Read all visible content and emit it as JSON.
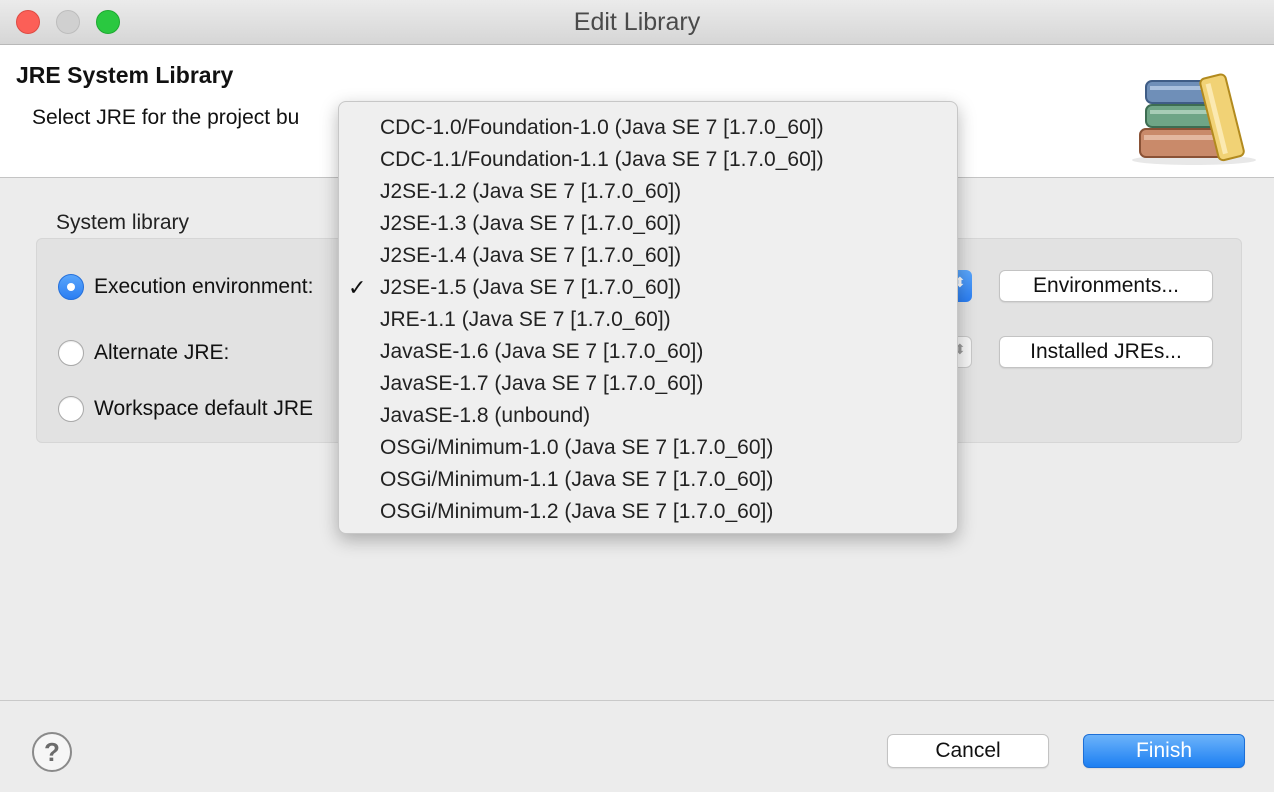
{
  "window": {
    "title": "Edit Library"
  },
  "banner": {
    "title": "JRE System Library",
    "description": "Select JRE for the project bu",
    "icon": "library-books-icon"
  },
  "system_library": {
    "label": "System library",
    "options": [
      {
        "label": "Execution environment:",
        "selected": true
      },
      {
        "label": "Alternate JRE:",
        "selected": false
      },
      {
        "label": "Workspace default JRE",
        "selected": false
      }
    ],
    "environments_button": "Environments...",
    "installed_jres_button": "Installed JREs..."
  },
  "dropdown": {
    "selected_index": 5,
    "check_glyph": "✓",
    "items": [
      "CDC-1.0/Foundation-1.0 (Java SE 7 [1.7.0_60])",
      "CDC-1.1/Foundation-1.1 (Java SE 7 [1.7.0_60])",
      "J2SE-1.2 (Java SE 7 [1.7.0_60])",
      "J2SE-1.3 (Java SE 7 [1.7.0_60])",
      "J2SE-1.4 (Java SE 7 [1.7.0_60])",
      "J2SE-1.5 (Java SE 7 [1.7.0_60])",
      "JRE-1.1 (Java SE 7 [1.7.0_60])",
      "JavaSE-1.6 (Java SE 7 [1.7.0_60])",
      "JavaSE-1.7 (Java SE 7 [1.7.0_60])",
      "JavaSE-1.8 (unbound)",
      "OSGi/Minimum-1.0 (Java SE 7 [1.7.0_60])",
      "OSGi/Minimum-1.1 (Java SE 7 [1.7.0_60])",
      "OSGi/Minimum-1.2 (Java SE 7 [1.7.0_60])"
    ]
  },
  "footer": {
    "help_glyph": "?",
    "cancel_label": "Cancel",
    "finish_label": "Finish"
  },
  "colors": {
    "accent": "#2b7ef2",
    "close": "#fc5f57",
    "maximize": "#2ac840"
  }
}
